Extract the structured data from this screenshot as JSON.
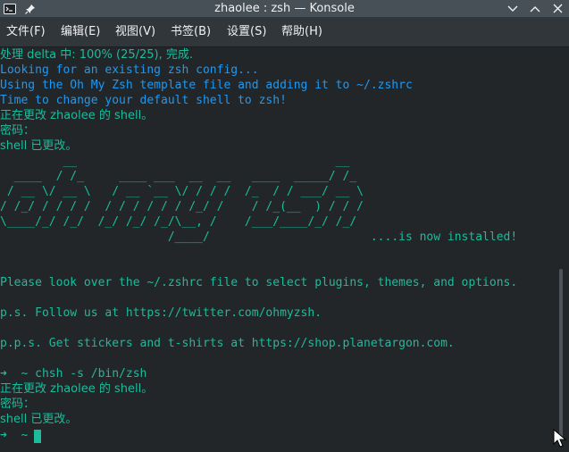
{
  "window": {
    "title": "zhaolee : zsh — Konsole",
    "icons": [
      "konsole-app-icon",
      "pin-icon",
      "chevron-down-icon",
      "chevron-up-icon",
      "close-icon"
    ]
  },
  "menubar": {
    "items": [
      "文件(F)",
      "编辑(E)",
      "视图(V)",
      "书签(B)",
      "设置(S)",
      "帮助(H)"
    ]
  },
  "terminal": {
    "lines": [
      "处理 delta 中: 100% (25/25), 完成.",
      "Looking for an existing zsh config...",
      "Using the Oh My Zsh template file and adding it to ~/.zshrc",
      "Time to change your default shell to zsh!",
      "正在更改 zhaolee 的 shell。",
      "密码：",
      "shell 已更改。",
      "         __                                     __",
      "  ____  / /_     ____ ___  __  __   ____  _____/ /_",
      " / __ \\/ __ \\   / __ `__ \\/ / / /  /_  / / ___/ __ \\",
      "/ /_/ / / / /  / / / / / / /_/ /    / /_(__  ) / / /",
      "\\____/_/ /_/  /_/ /_/ /_/\\__, /    /___/____/_/ /_/",
      "                        /____/                       ....is now installed!",
      "",
      "",
      "Please look over the ~/.zshrc file to select plugins, themes, and options.",
      "",
      "p.s. Follow us at https://twitter.com/ohmyzsh.",
      "",
      "p.p.s. Get stickers and t-shirts at https://shop.planetargon.com.",
      "",
      "➜  ~ chsh -s /bin/zsh",
      "正在更改 zhaolee 的 shell。",
      "密码：",
      "shell 已更改。",
      "➜  ~ "
    ],
    "colors": {
      "background": "#232629",
      "green": "#1abc9c",
      "blue": "#1d99f3"
    }
  }
}
